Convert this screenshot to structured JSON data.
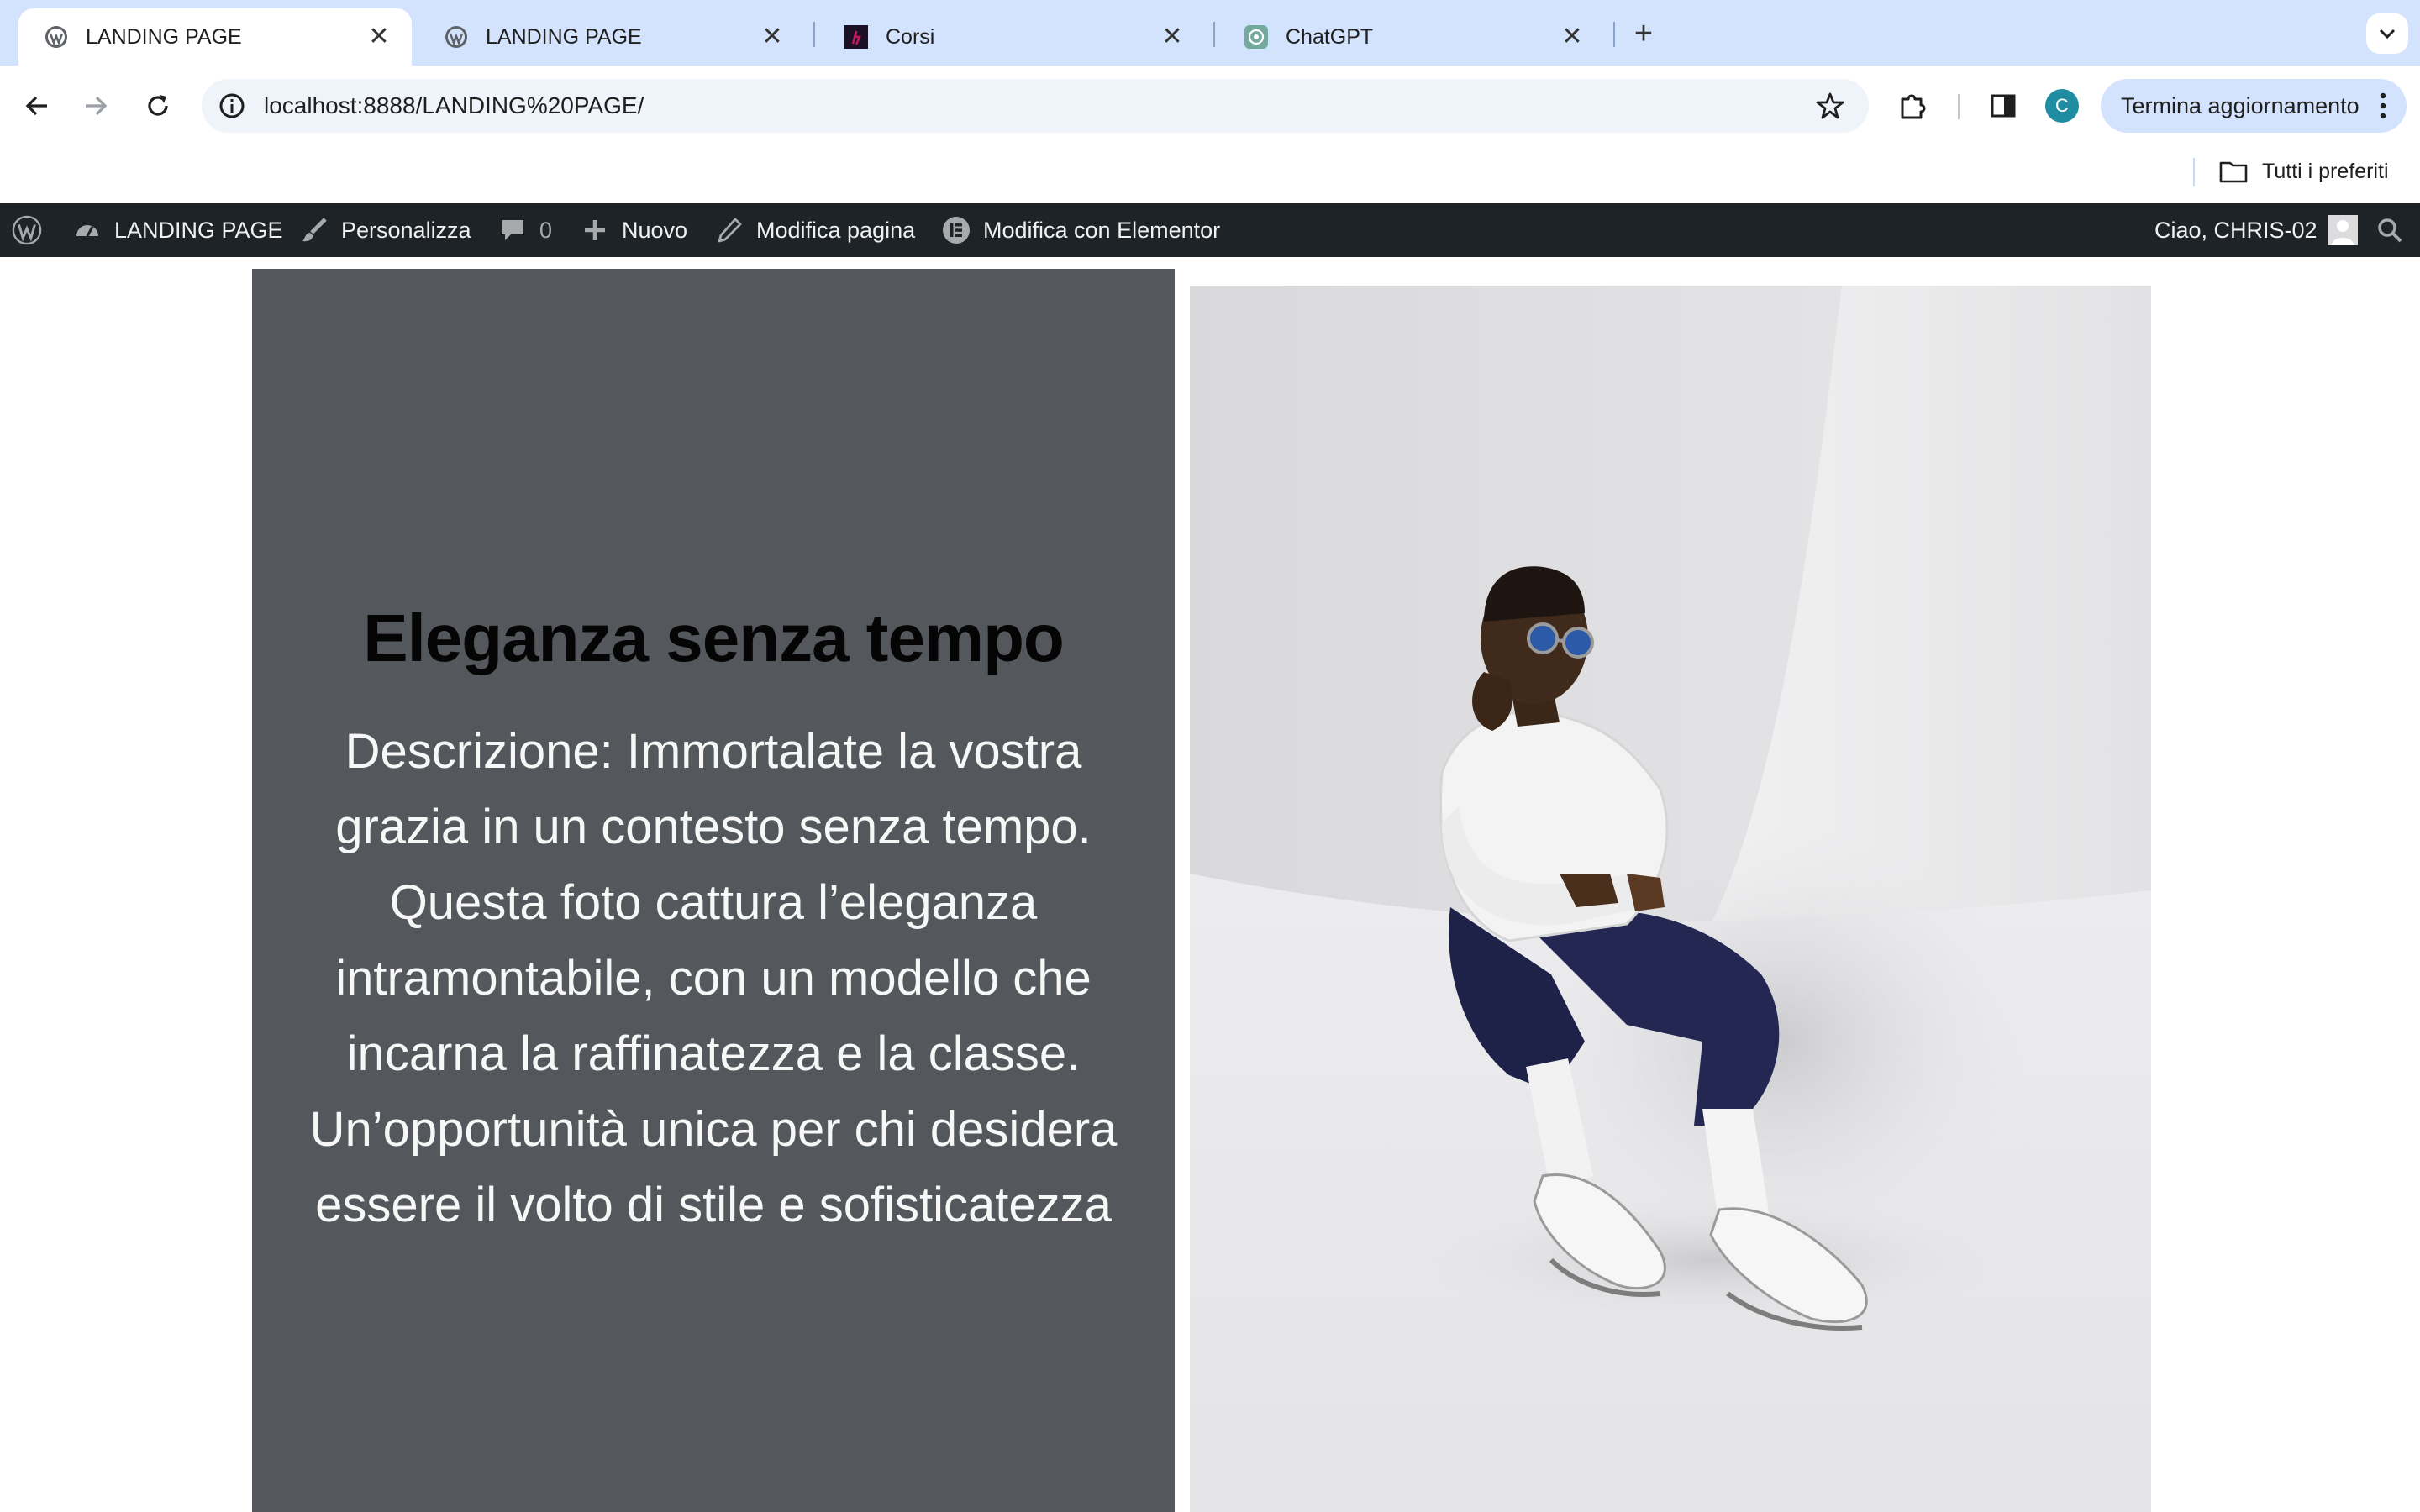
{
  "browser": {
    "tabs": [
      {
        "title": "LANDING PAGE",
        "favicon": "wordpress-favicon",
        "active": true
      },
      {
        "title": "LANDING PAGE",
        "favicon": "wordpress-favicon",
        "active": false
      },
      {
        "title": "Corsi",
        "favicon": "corsi-favicon",
        "active": false
      },
      {
        "title": "ChatGPT",
        "favicon": "chatgpt-favicon",
        "active": false
      }
    ],
    "url": "localhost:8888/LANDING%20PAGE/",
    "profile_initial": "C",
    "update_button": "Termina aggiornamento",
    "bookmarks_folder": "Tutti i preferiti"
  },
  "adminbar": {
    "site_name": "LANDING PAGE",
    "customize": "Personalizza",
    "comments_count": "0",
    "new": "Nuovo",
    "edit_page": "Modifica pagina",
    "edit_elementor": "Modifica con Elementor",
    "greeting": "Ciao, CHRIS-02"
  },
  "hero": {
    "title": "Eleganza senza tempo",
    "description": "Descrizione: Immortalate la vostra grazia in un contesto senza tempo. Questa foto cattura l’eleganza intramontabile, con un modello che incarna la raffinatezza e la classe. Un’opportunità unica per chi desidera essere il volto di stile e sofisticatezza"
  },
  "colors": {
    "tabstrip": "#d3e3fd",
    "adminbar": "#1d2327",
    "panel": "#54575c"
  }
}
